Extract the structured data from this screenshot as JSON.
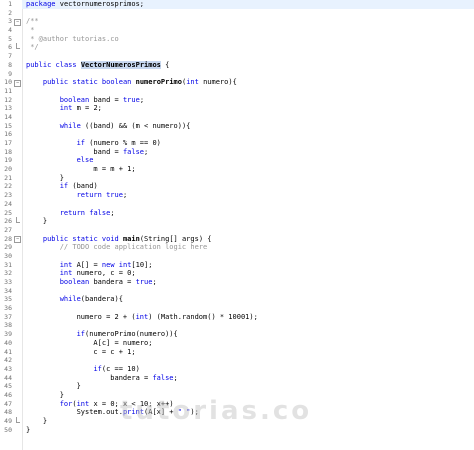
{
  "editor": {
    "lines": [
      {
        "n": "1",
        "fold": "",
        "html": "<span class=\"kw\">package</span> vectornumerosprimos;"
      },
      {
        "n": "2",
        "fold": "",
        "html": ""
      },
      {
        "n": "3",
        "fold": "open",
        "html": "<span class=\"cm\">/**</span>"
      },
      {
        "n": "4",
        "fold": "",
        "html": "<span class=\"cm\"> *</span>"
      },
      {
        "n": "5",
        "fold": "",
        "html": "<span class=\"cm\"> * @author tutorias.co</span>"
      },
      {
        "n": "6",
        "fold": "end",
        "html": "<span class=\"cm\"> */</span>"
      },
      {
        "n": "7",
        "fold": "",
        "html": ""
      },
      {
        "n": "8",
        "fold": "",
        "html": "<span class=\"kw\">public</span> <span class=\"kw\">class</span> <span class=\"hl bold\">VectorNumerosPrimos</span> {"
      },
      {
        "n": "9",
        "fold": "",
        "html": ""
      },
      {
        "n": "10",
        "fold": "open",
        "html": "    <span class=\"kw\">public</span> <span class=\"kw\">static</span> <span class=\"kw\">boolean</span> <span class=\"bold\">numeroPrimo</span>(<span class=\"kw\">int</span> numero){"
      },
      {
        "n": "11",
        "fold": "",
        "html": ""
      },
      {
        "n": "12",
        "fold": "",
        "html": "        <span class=\"kw\">boolean</span> band = <span class=\"kw\">true</span>;"
      },
      {
        "n": "13",
        "fold": "",
        "html": "        <span class=\"kw\">int</span> m = 2;"
      },
      {
        "n": "14",
        "fold": "",
        "html": ""
      },
      {
        "n": "15",
        "fold": "",
        "html": "        <span class=\"kw\">while</span> ((band) &amp;&amp; (m &lt; numero)){"
      },
      {
        "n": "16",
        "fold": "",
        "html": ""
      },
      {
        "n": "17",
        "fold": "",
        "html": "            <span class=\"kw\">if</span> (numero % m == 0)"
      },
      {
        "n": "18",
        "fold": "",
        "html": "                band = <span class=\"kw\">false</span>;"
      },
      {
        "n": "19",
        "fold": "",
        "html": "            <span class=\"kw\">else</span>"
      },
      {
        "n": "20",
        "fold": "",
        "html": "                m = m + 1;"
      },
      {
        "n": "21",
        "fold": "",
        "html": "        }"
      },
      {
        "n": "22",
        "fold": "",
        "html": "        <span class=\"kw\">if</span> (band)"
      },
      {
        "n": "23",
        "fold": "",
        "html": "            <span class=\"kw\">return</span> <span class=\"kw\">true</span>;"
      },
      {
        "n": "24",
        "fold": "",
        "html": ""
      },
      {
        "n": "25",
        "fold": "",
        "html": "        <span class=\"kw\">return</span> <span class=\"kw\">false</span>;"
      },
      {
        "n": "26",
        "fold": "end",
        "html": "    }"
      },
      {
        "n": "27",
        "fold": "",
        "html": ""
      },
      {
        "n": "28",
        "fold": "open",
        "html": "    <span class=\"kw\">public</span> <span class=\"kw\">static</span> <span class=\"kw\">void</span> <span class=\"bold\">main</span>(String[] args) {"
      },
      {
        "n": "29",
        "fold": "",
        "html": "        <span class=\"cm\">// TODO code application logic here</span>"
      },
      {
        "n": "30",
        "fold": "",
        "html": ""
      },
      {
        "n": "31",
        "fold": "",
        "html": "        <span class=\"kw\">int</span> A[] = <span class=\"kw\">new</span> <span class=\"kw\">int</span>[10];"
      },
      {
        "n": "32",
        "fold": "",
        "html": "        <span class=\"kw\">int</span> numero, c = 0;"
      },
      {
        "n": "33",
        "fold": "",
        "html": "        <span class=\"kw\">boolean</span> bandera = <span class=\"kw\">true</span>;"
      },
      {
        "n": "34",
        "fold": "",
        "html": ""
      },
      {
        "n": "35",
        "fold": "",
        "html": "        <span class=\"kw\">while</span>(bandera){"
      },
      {
        "n": "36",
        "fold": "",
        "html": ""
      },
      {
        "n": "37",
        "fold": "",
        "html": "            numero = 2 + (<span class=\"kw\">int</span>) (Math.random() * 10001);"
      },
      {
        "n": "38",
        "fold": "",
        "html": ""
      },
      {
        "n": "39",
        "fold": "",
        "html": "            <span class=\"kw\">if</span>(numeroPrimo(numero)){"
      },
      {
        "n": "40",
        "fold": "",
        "html": "                A[c] = numero;"
      },
      {
        "n": "41",
        "fold": "",
        "html": "                c = c + 1;"
      },
      {
        "n": "42",
        "fold": "",
        "html": ""
      },
      {
        "n": "43",
        "fold": "",
        "html": "                <span class=\"kw\">if</span>(c == 10)"
      },
      {
        "n": "44",
        "fold": "",
        "html": "                    bandera = <span class=\"kw\">false</span>;"
      },
      {
        "n": "45",
        "fold": "",
        "html": "            }"
      },
      {
        "n": "46",
        "fold": "",
        "html": "        }"
      },
      {
        "n": "47",
        "fold": "",
        "html": "        <span class=\"kw\">for</span>(<span class=\"kw\">int</span> x = 0; x &lt; 10; x++)"
      },
      {
        "n": "48",
        "fold": "",
        "html": "            System.out.<span class=\"kw\">print</span>(A[x] + <span class=\"kw\">\" \"</span>);"
      },
      {
        "n": "49",
        "fold": "end",
        "html": "    }"
      },
      {
        "n": "50",
        "fold": "",
        "html": "}"
      }
    ],
    "current_line": "1",
    "watermark": "tutorias.co"
  }
}
